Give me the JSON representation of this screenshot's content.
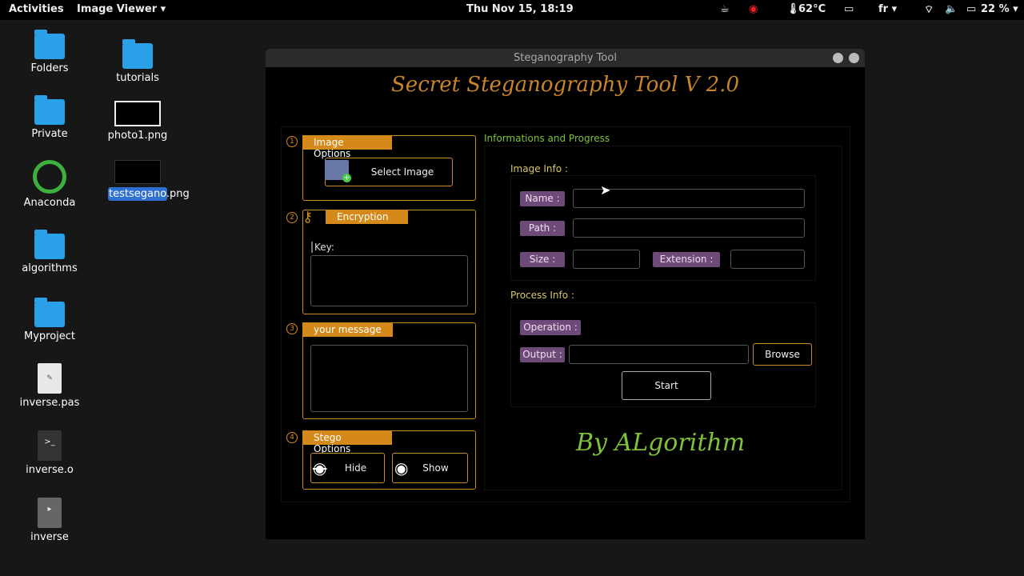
{
  "topbar": {
    "activities": "Activities",
    "app": "Image Viewer ▾",
    "clock": "Thu Nov 15, 18:19",
    "temp": "62°C",
    "lang": "fr ▾",
    "battery": "22 % ▾"
  },
  "desktop": {
    "col1": [
      {
        "label": "Folders",
        "type": "folder"
      },
      {
        "label": "Private",
        "type": "folder"
      },
      {
        "label": "Anaconda",
        "type": "anaconda"
      },
      {
        "label": "algorithms",
        "type": "folder"
      },
      {
        "label": "Myproject",
        "type": "folder"
      },
      {
        "label": "inverse.pas",
        "type": "text"
      },
      {
        "label": "inverse.o",
        "type": "term"
      },
      {
        "label": "inverse",
        "type": "exec"
      }
    ],
    "col2": [
      {
        "label": "tutorials"
      },
      {
        "label": "photo1.png"
      },
      {
        "label": "testsegano.png"
      }
    ]
  },
  "window": {
    "title": "Steganography Tool",
    "app_title": "Secret Steganography Tool V 2.0",
    "left": {
      "n1": "1",
      "image_options": "Image Options",
      "select_image": "Select Image",
      "n2": "2",
      "encryption": "Encryption",
      "key_label": "Key:",
      "n3": "3",
      "your_message": "your message",
      "n4": "4",
      "stego_options": "Stego Options",
      "hide": "Hide",
      "show": "Show"
    },
    "right": {
      "section": "Informations and Progress",
      "image_info": "Image Info :",
      "name": "Name :",
      "path": "Path :",
      "size": "Size :",
      "extension": "Extension :",
      "process_info": "Process Info :",
      "operation": "Operation :",
      "output": "Output :",
      "browse": "Browse",
      "start": "Start",
      "signature": "By ALgorithm"
    }
  }
}
